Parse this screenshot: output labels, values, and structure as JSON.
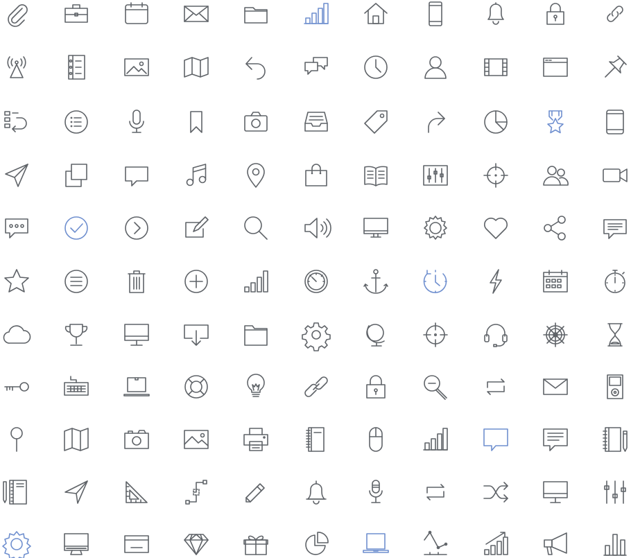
{
  "colors": {
    "stroke": "#5f6368",
    "accent": "#6f8fcf",
    "background": "#ffffff"
  },
  "rows": [
    [
      {
        "icon": "paperclip-icon"
      },
      {
        "icon": "briefcase-icon"
      },
      {
        "icon": "calendar-icon"
      },
      {
        "icon": "envelope-icon"
      },
      {
        "icon": "folder-icon"
      },
      {
        "icon": "bar-chart-icon",
        "accent": true
      },
      {
        "icon": "home-icon"
      },
      {
        "icon": "smartphone-icon"
      },
      {
        "icon": "bell-icon"
      },
      {
        "icon": "padlock-icon"
      },
      {
        "icon": "link-icon"
      }
    ],
    [
      {
        "icon": "broadcast-tower-icon"
      },
      {
        "icon": "notebook-icon"
      },
      {
        "icon": "image-icon"
      },
      {
        "icon": "map-icon"
      },
      {
        "icon": "undo-arrow-icon"
      },
      {
        "icon": "chat-bubbles-icon"
      },
      {
        "icon": "clock-icon"
      },
      {
        "icon": "user-icon"
      },
      {
        "icon": "film-strip-icon"
      },
      {
        "icon": "browser-window-icon"
      },
      {
        "icon": "pushpin-icon"
      }
    ],
    [
      {
        "icon": "list-refresh-icon"
      },
      {
        "icon": "list-circle-icon"
      },
      {
        "icon": "microphone-icon"
      },
      {
        "icon": "bookmark-icon"
      },
      {
        "icon": "camera-icon"
      },
      {
        "icon": "inbox-tray-icon"
      },
      {
        "icon": "tag-icon"
      },
      {
        "icon": "redo-arrow-icon"
      },
      {
        "icon": "pie-chart-icon"
      },
      {
        "icon": "award-ribbon-icon",
        "accent": true
      },
      {
        "icon": "tablet-icon"
      }
    ],
    [
      {
        "icon": "paper-plane-icon"
      },
      {
        "icon": "copy-icon"
      },
      {
        "icon": "speech-bubble-icon"
      },
      {
        "icon": "music-note-icon"
      },
      {
        "icon": "map-pin-icon"
      },
      {
        "icon": "shopping-bag-icon"
      },
      {
        "icon": "open-book-icon"
      },
      {
        "icon": "equalizer-icon"
      },
      {
        "icon": "crosshair-icon"
      },
      {
        "icon": "users-icon"
      },
      {
        "icon": "video-camera-icon"
      }
    ],
    [
      {
        "icon": "message-dots-icon"
      },
      {
        "icon": "check-circle-icon",
        "accent": true
      },
      {
        "icon": "chevron-right-circle-icon"
      },
      {
        "icon": "edit-box-icon"
      },
      {
        "icon": "search-icon"
      },
      {
        "icon": "speaker-volume-icon"
      },
      {
        "icon": "monitor-icon"
      },
      {
        "icon": "gear-icon"
      },
      {
        "icon": "heart-icon"
      },
      {
        "icon": "share-icon"
      },
      {
        "icon": "comment-lines-icon"
      }
    ],
    [
      {
        "icon": "star-icon"
      },
      {
        "icon": "menu-circle-icon"
      },
      {
        "icon": "trash-icon"
      },
      {
        "icon": "plus-circle-icon"
      },
      {
        "icon": "signal-bars-icon"
      },
      {
        "icon": "speedometer-icon"
      },
      {
        "icon": "anchor-icon"
      },
      {
        "icon": "history-clock-icon",
        "accent": true
      },
      {
        "icon": "lightning-icon"
      },
      {
        "icon": "calendar-grid-icon"
      },
      {
        "icon": "stopwatch-icon"
      }
    ],
    [
      {
        "icon": "cloud-icon"
      },
      {
        "icon": "trophy-icon"
      },
      {
        "icon": "desktop-icon"
      },
      {
        "icon": "download-tray-icon"
      },
      {
        "icon": "folder-open-icon"
      },
      {
        "icon": "cog-icon"
      },
      {
        "icon": "globe-icon"
      },
      {
        "icon": "target-icon"
      },
      {
        "icon": "headset-icon"
      },
      {
        "icon": "ship-wheel-icon"
      },
      {
        "icon": "hourglass-icon"
      }
    ],
    [
      {
        "icon": "key-icon"
      },
      {
        "icon": "keyboard-icon"
      },
      {
        "icon": "laptop-icon"
      },
      {
        "icon": "lifebuoy-icon"
      },
      {
        "icon": "lightbulb-icon"
      },
      {
        "icon": "chain-link-icon"
      },
      {
        "icon": "lock-icon"
      },
      {
        "icon": "zoom-out-icon"
      },
      {
        "icon": "repeat-arrows-icon"
      },
      {
        "icon": "mail-icon"
      },
      {
        "icon": "music-player-icon"
      }
    ],
    [
      {
        "icon": "thumbtack-icon"
      },
      {
        "icon": "folded-map-icon"
      },
      {
        "icon": "photo-camera-icon"
      },
      {
        "icon": "picture-icon"
      },
      {
        "icon": "printer-icon"
      },
      {
        "icon": "ruled-notebook-icon"
      },
      {
        "icon": "mouse-icon"
      },
      {
        "icon": "stats-bars-icon"
      },
      {
        "icon": "chat-box-icon",
        "accent": true
      },
      {
        "icon": "message-lines-icon"
      },
      {
        "icon": "notebook-pen-icon"
      }
    ],
    [
      {
        "icon": "journal-pencil-icon"
      },
      {
        "icon": "send-icon"
      },
      {
        "icon": "set-square-icon"
      },
      {
        "icon": "vector-path-icon"
      },
      {
        "icon": "pencil-icon"
      },
      {
        "icon": "alarm-bell-icon"
      },
      {
        "icon": "studio-mic-icon"
      },
      {
        "icon": "loop-icon"
      },
      {
        "icon": "shuffle-icon"
      },
      {
        "icon": "computer-screen-icon"
      },
      {
        "icon": "sliders-icon"
      }
    ],
    [
      {
        "icon": "settings-icon",
        "accent": true
      },
      {
        "icon": "imac-icon"
      },
      {
        "icon": "credit-card-icon"
      },
      {
        "icon": "diamond-icon"
      },
      {
        "icon": "gift-icon"
      },
      {
        "icon": "pie-slice-icon"
      },
      {
        "icon": "notebook-computer-icon",
        "accent": true
      },
      {
        "icon": "line-graph-icon"
      },
      {
        "icon": "growth-chart-icon"
      },
      {
        "icon": "megaphone-icon"
      },
      {
        "icon": "column-chart-icon"
      }
    ]
  ]
}
